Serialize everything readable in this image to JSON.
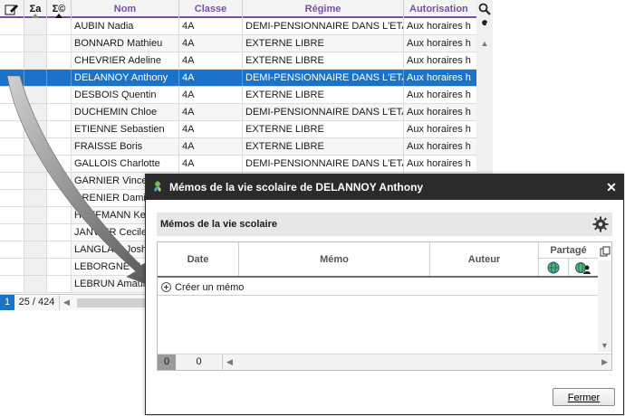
{
  "grid": {
    "columns": [
      "",
      "Σa",
      "Σ©",
      "Nom",
      "Classe",
      "Régime",
      "Autorisation"
    ],
    "rows": [
      {
        "nom": "AUBIN Nadia",
        "classe": "4A",
        "regime": "DEMI-PENSIONNAIRE DANS L'ETABL",
        "autorisation": "Aux horaires h"
      },
      {
        "nom": "BONNARD Mathieu",
        "classe": "4A",
        "regime": "EXTERNE LIBRE",
        "autorisation": "Aux horaires h"
      },
      {
        "nom": "CHEVRIER Adeline",
        "classe": "4A",
        "regime": "EXTERNE LIBRE",
        "autorisation": "Aux horaires h"
      },
      {
        "nom": "DELANNOY Anthony",
        "classe": "4A",
        "regime": "DEMI-PENSIONNAIRE DANS L'ETABL",
        "autorisation": "Aux horaires h"
      },
      {
        "nom": "DESBOIS Quentin",
        "classe": "4A",
        "regime": "EXTERNE LIBRE",
        "autorisation": "Aux horaires h"
      },
      {
        "nom": "DUCHEMIN Chloe",
        "classe": "4A",
        "regime": "DEMI-PENSIONNAIRE DANS L'ETABL",
        "autorisation": "Aux horaires h"
      },
      {
        "nom": "ETIENNE Sebastien",
        "classe": "4A",
        "regime": "EXTERNE LIBRE",
        "autorisation": "Aux horaires h"
      },
      {
        "nom": "FRAISSE Boris",
        "classe": "4A",
        "regime": "EXTERNE LIBRE",
        "autorisation": "Aux horaires h"
      },
      {
        "nom": "GALLOIS Charlotte",
        "classe": "4A",
        "regime": "DEMI-PENSIONNAIRE DANS L'ETABL",
        "autorisation": "Aux horaires h"
      },
      {
        "nom": "GARNIER Vince",
        "classe": "",
        "regime": "",
        "autorisation": ""
      },
      {
        "nom": "GRENIER Damis",
        "classe": "",
        "regime": "",
        "autorisation": ""
      },
      {
        "nom": "HOFFMANN Kev",
        "classe": "",
        "regime": "",
        "autorisation": ""
      },
      {
        "nom": "JANVIER Cecile",
        "classe": "",
        "regime": "",
        "autorisation": ""
      },
      {
        "nom": "LANGLAIS Josh",
        "classe": "",
        "regime": "",
        "autorisation": ""
      },
      {
        "nom": "LEBORGNE Mar",
        "classe": "",
        "regime": "",
        "autorisation": ""
      },
      {
        "nom": "LEBRUN Amaury",
        "classe": "",
        "regime": "",
        "autorisation": ""
      }
    ],
    "selected_index": 3,
    "footer": {
      "page": "1",
      "count": "25 / 424"
    }
  },
  "dialog": {
    "title": "Mémos de la vie scolaire de DELANNOY Anthony",
    "section_title": "Mémos de la vie scolaire",
    "columns": {
      "date": "Date",
      "memo": "Mémo",
      "auteur": "Auteur",
      "partage": "Partagé"
    },
    "create_label": "Créer un mémo",
    "footer": {
      "selected": "0",
      "count": "0"
    },
    "close_button": "Fermer"
  },
  "colors": {
    "accent": "#7a4fa0",
    "selection": "#1a73c8",
    "titlebar": "#2b2b2b"
  }
}
